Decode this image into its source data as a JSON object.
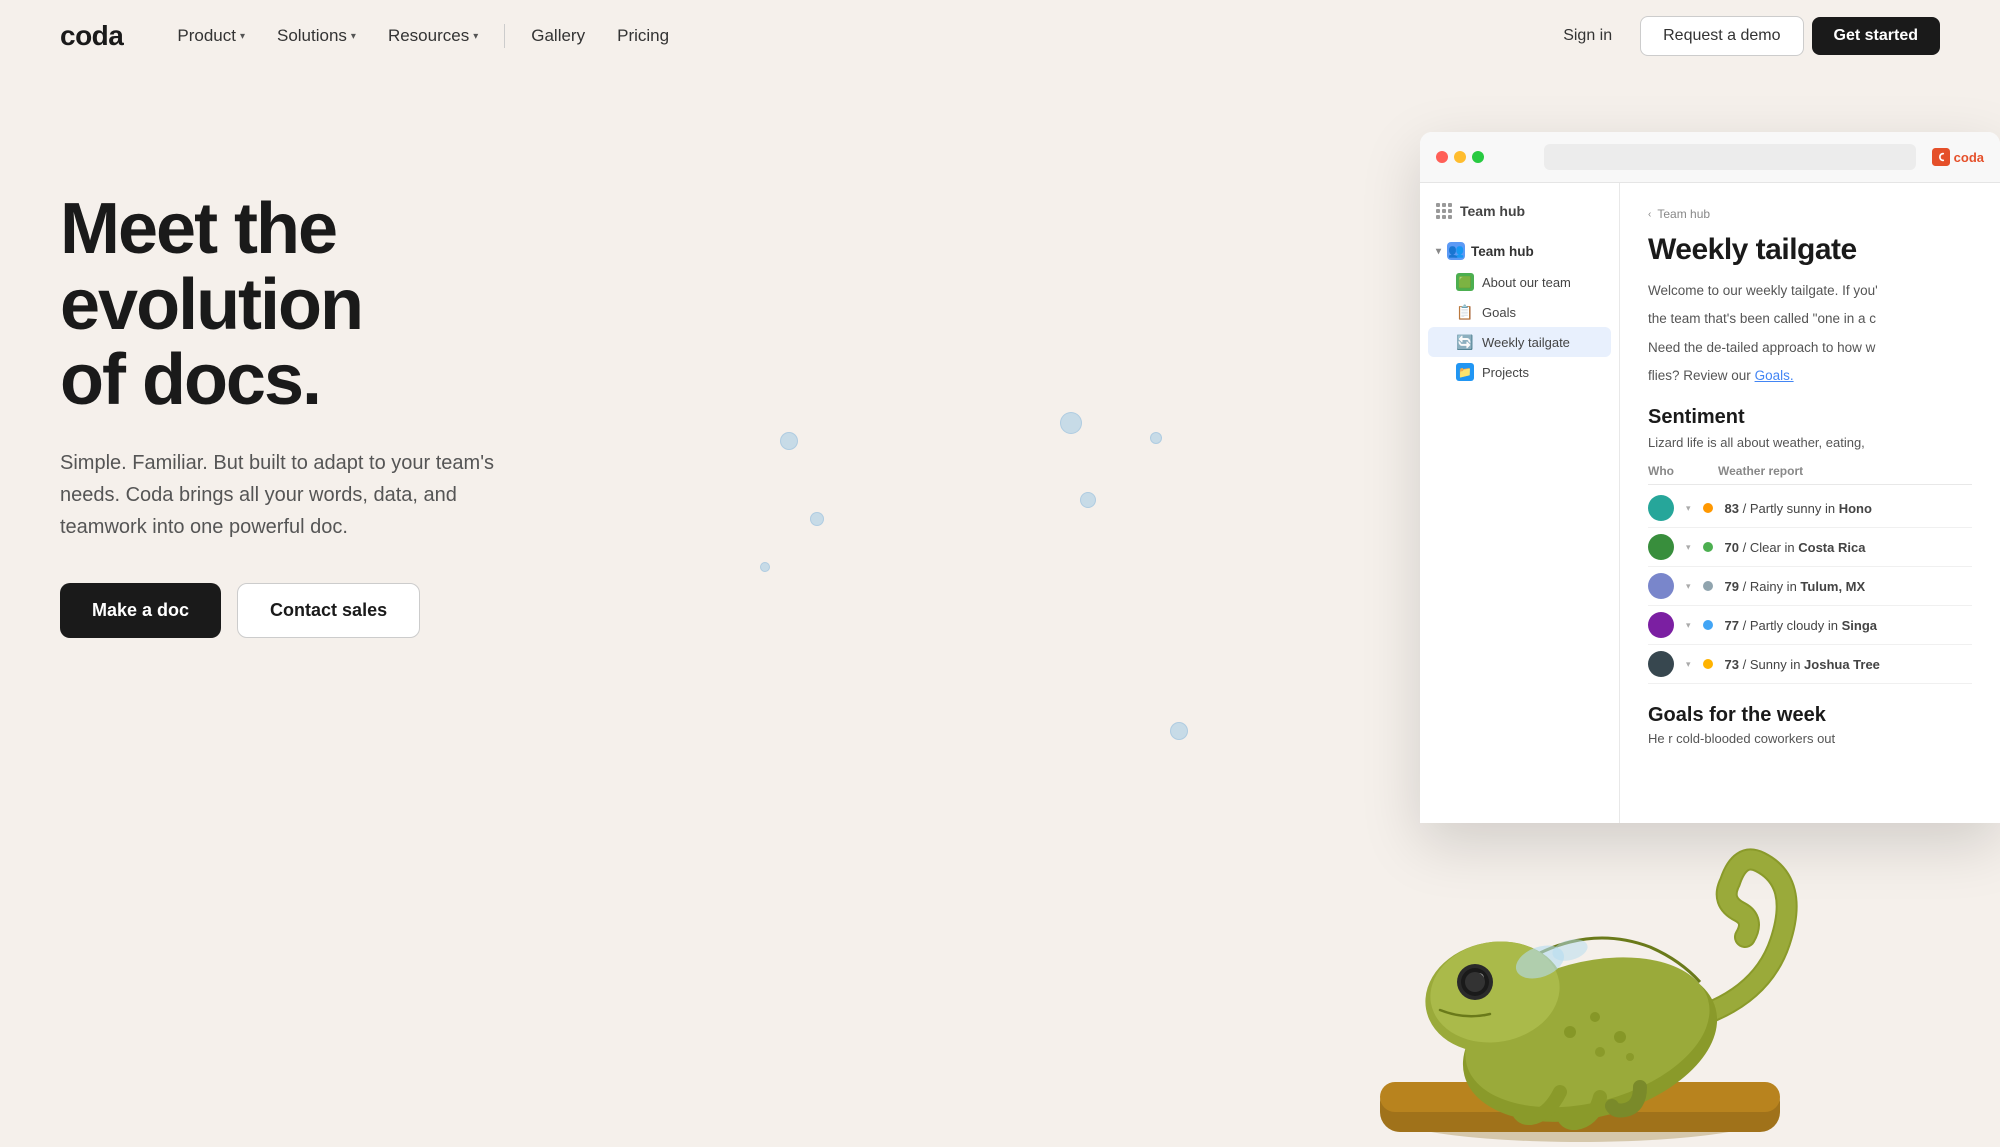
{
  "brand": {
    "logo": "coda",
    "icon_color": "#e5502a"
  },
  "nav": {
    "product_label": "Product",
    "solutions_label": "Solutions",
    "resources_label": "Resources",
    "gallery_label": "Gallery",
    "pricing_label": "Pricing",
    "signin_label": "Sign in",
    "request_demo_label": "Request a demo",
    "get_started_label": "Get started"
  },
  "hero": {
    "title_line1": "Meet the evolution",
    "title_line2": "of docs.",
    "subtitle": "Simple. Familiar. But built to adapt to your team's needs. Coda brings all your words, data, and teamwork into one powerful doc.",
    "make_doc_label": "Make a doc",
    "contact_sales_label": "Contact sales"
  },
  "app_mockup": {
    "breadcrumb": "Team hub",
    "page_title": "Weekly tailgate",
    "page_desc_1": "Welcome to our weekly tailgate. If you'",
    "page_desc_2": "the team that's been called \"one in a c",
    "page_desc_3": "Need the de-tailed approach to how w",
    "page_desc_4": "flies? Review our",
    "goals_link": "Goals.",
    "sentiment_title": "Sentiment",
    "sentiment_desc": "Lizard life is all about weather, eating,",
    "table_headers": {
      "who": "Who",
      "weather": "Weather report"
    },
    "weather_rows": [
      {
        "temp": "83",
        "condition": "Partly sunny in",
        "location": "Hono",
        "dot_color": "dot-orange",
        "avatar_color": "avatar-teal"
      },
      {
        "temp": "70",
        "condition": "Clear in",
        "location": "Costa Rica",
        "dot_color": "dot-green",
        "avatar_color": "avatar-green"
      },
      {
        "temp": "79",
        "condition": "Rainy in",
        "location": "Tulum, MX",
        "dot_color": "dot-gray",
        "avatar_color": "avatar-blue"
      },
      {
        "temp": "77",
        "condition": "Partly cloudy in",
        "location": "Singa",
        "dot_color": "dot-blue",
        "avatar_color": "avatar-purple"
      },
      {
        "temp": "73",
        "condition": "Sunny in",
        "location": "Joshua Tree",
        "dot_color": "dot-sun",
        "avatar_color": "avatar-dark"
      }
    ],
    "goals_section_title": "Goals for the week",
    "goals_section_desc": "He    r cold-blooded coworkers out",
    "sidebar": {
      "header": "Team hub",
      "team_hub_label": "Team hub",
      "about_team_label": "About our team",
      "goals_label": "Goals",
      "weekly_tailgate_label": "Weekly tailgate",
      "projects_label": "Projects"
    }
  }
}
